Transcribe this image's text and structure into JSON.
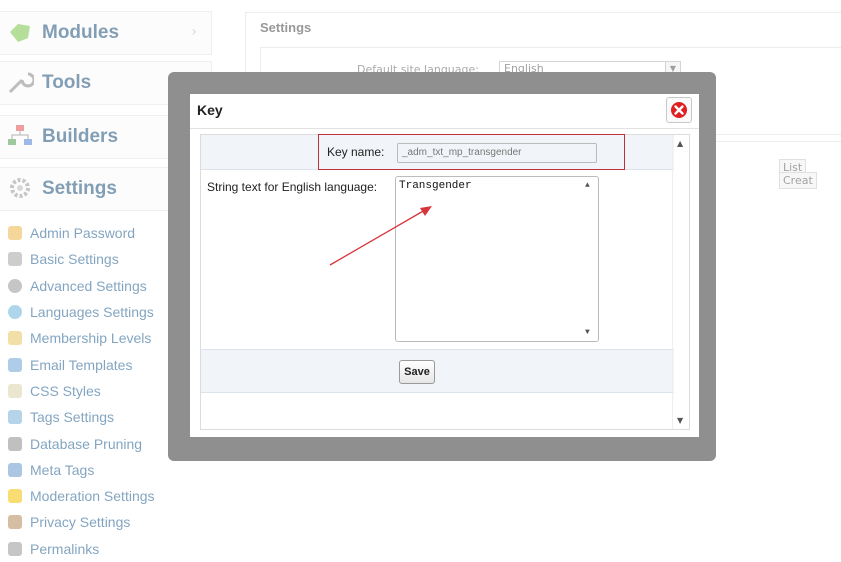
{
  "sidebar": {
    "menus": [
      {
        "label": "Modules",
        "icon": "puzzle-icon"
      },
      {
        "label": "Tools",
        "icon": "wrench-icon"
      },
      {
        "label": "Builders",
        "icon": "builder-icon"
      },
      {
        "label": "Settings",
        "icon": "gear-icon"
      }
    ],
    "items": [
      {
        "label": "Admin Password",
        "icon": "key-icon",
        "color": "#f0b84a"
      },
      {
        "label": "Basic Settings",
        "icon": "wrench-icon",
        "color": "#a6a6a6"
      },
      {
        "label": "Advanced Settings",
        "icon": "cog-icon",
        "color": "#999999"
      },
      {
        "label": "Languages Settings",
        "icon": "globe-icon",
        "color": "#6fb3e0"
      },
      {
        "label": "Membership Levels",
        "icon": "medal-icon",
        "color": "#e8c560"
      },
      {
        "label": "Email Templates",
        "icon": "email-icon",
        "color": "#6fa6d6"
      },
      {
        "label": "CSS Styles",
        "icon": "css-icon",
        "color": "#d9d3a8"
      },
      {
        "label": "Tags Settings",
        "icon": "tag-icon",
        "color": "#7ab0d8"
      },
      {
        "label": "Database Pruning",
        "icon": "database-icon",
        "color": "#8e8e8e"
      },
      {
        "label": "Meta Tags",
        "icon": "code-icon",
        "color": "#6699cc"
      },
      {
        "label": "Moderation Settings",
        "icon": "warning-icon",
        "color": "#f2c200"
      },
      {
        "label": "Privacy Settings",
        "icon": "privacy-icon",
        "color": "#b58a5a"
      },
      {
        "label": "Permalinks",
        "icon": "link-icon",
        "color": "#999999"
      }
    ]
  },
  "main": {
    "title": "Settings",
    "default_language_label": "Default site language:",
    "default_language_value": "English",
    "tab_list": "List",
    "tab_create": "Creat"
  },
  "dialog": {
    "title": "Key",
    "key_name_label": "Key name:",
    "key_name_value": "_adm_txt_mp_transgender",
    "string_label": "String text for English language:",
    "string_value": "Transgender",
    "save_label": "Save"
  },
  "colors": {
    "highlight": "#c0303a",
    "overlay": "#8f8f8f",
    "close_button": "#e02020"
  }
}
